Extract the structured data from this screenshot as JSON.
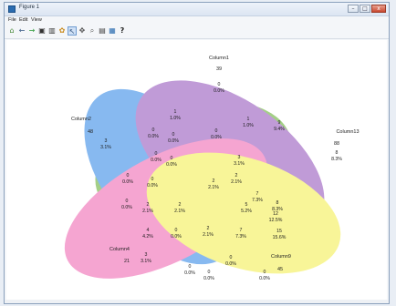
{
  "window": {
    "title": "Figure 1",
    "buttons": {
      "minimize": "–",
      "maximize": "□",
      "close": "x"
    }
  },
  "menu": {
    "items": [
      "File",
      "Edit",
      "View"
    ]
  },
  "toolbar": {
    "icons": [
      {
        "name": "home-icon",
        "glyph": "⌂"
      },
      {
        "name": "back-icon",
        "glyph": "←"
      },
      {
        "name": "forward-icon",
        "glyph": "→"
      },
      {
        "name": "camera-icon",
        "glyph": "▣"
      },
      {
        "name": "chart-icon",
        "glyph": "▥"
      },
      {
        "name": "colorwheel-icon",
        "glyph": "✿"
      },
      {
        "name": "pointer-icon",
        "glyph": "↖"
      },
      {
        "name": "pan-icon",
        "glyph": "✥"
      },
      {
        "name": "zoom-icon",
        "glyph": "⌕"
      },
      {
        "name": "subplot-icon",
        "glyph": "▤"
      },
      {
        "name": "save-icon",
        "glyph": "▦"
      },
      {
        "name": "help-icon",
        "glyph": "?"
      }
    ]
  },
  "venn": {
    "sets": [
      {
        "id": "col1",
        "label": "Column1",
        "count": "39",
        "color": "#6db33f"
      },
      {
        "id": "col2",
        "label": "Column2",
        "count": "48",
        "color": "#3f8fe8"
      },
      {
        "id": "col13",
        "label": "Column13",
        "count": "88",
        "color": "#9b5fc0"
      },
      {
        "id": "col4",
        "label": "Column4",
        "count": "21",
        "color": "#ef6fb5"
      },
      {
        "id": "col9",
        "label": "Column9",
        "count": "45",
        "color": "#f4f05a"
      }
    ],
    "regions": [
      {
        "n": "0",
        "p": "0.0%"
      },
      {
        "n": "1",
        "p": "1.0%"
      },
      {
        "n": "0",
        "p": "0.0%"
      },
      {
        "n": "0",
        "p": "0.0%"
      },
      {
        "n": "1",
        "p": "1.0%"
      },
      {
        "n": "9",
        "p": "9.4%"
      },
      {
        "n": "3",
        "p": "3.1%"
      },
      {
        "n": "0",
        "p": "0.0%"
      },
      {
        "n": "0",
        "p": "0.0%"
      },
      {
        "n": "0",
        "p": "0.0%"
      },
      {
        "n": "3",
        "p": "3.1%"
      },
      {
        "n": "2",
        "p": "2.1%"
      },
      {
        "n": "8",
        "p": "8.3%"
      },
      {
        "n": "0",
        "p": "0.0%"
      },
      {
        "n": "0",
        "p": "0.0%"
      },
      {
        "n": "2",
        "p": "2.1%"
      },
      {
        "n": "7",
        "p": "7.3%"
      },
      {
        "n": "8",
        "p": "8.3%"
      },
      {
        "n": "0",
        "p": "0.0%"
      },
      {
        "n": "2",
        "p": "2.1%"
      },
      {
        "n": "2",
        "p": "2.1%"
      },
      {
        "n": "5",
        "p": "5.2%"
      },
      {
        "n": "12",
        "p": "12.5%"
      },
      {
        "n": "4",
        "p": "4.2%"
      },
      {
        "n": "0",
        "p": "0.0%"
      },
      {
        "n": "2",
        "p": "2.1%"
      },
      {
        "n": "7",
        "p": "7.3%"
      },
      {
        "n": "15",
        "p": "15.6%"
      },
      {
        "n": "3",
        "p": "3.1%"
      },
      {
        "n": "0",
        "p": "0.0%"
      },
      {
        "n": "0",
        "p": "0.0%"
      },
      {
        "n": "0",
        "p": "0.0%"
      },
      {
        "n": "0",
        "p": "0.0%"
      }
    ]
  }
}
